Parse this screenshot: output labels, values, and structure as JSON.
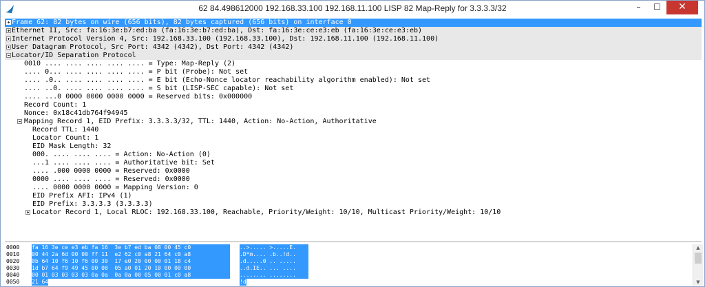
{
  "window": {
    "title": "62 84.498612000 192.168.33.100 192.168.11.100 LISP 82 Map-Reply for 3.3.3.3/32",
    "minimize": "–",
    "maximize": "☐",
    "close": "✕"
  },
  "tree": [
    {
      "text": "Frame 62: 82 bytes on wire (656 bits), 82 bytes captured (656 bits) on interface 0",
      "indent": 0,
      "expander": "plus",
      "selected": true
    },
    {
      "text": "Ethernet II, Src: fa:16:3e:b7:ed:ba (fa:16:3e:b7:ed:ba), Dst: fa:16:3e:ce:e3:eb (fa:16:3e:ce:e3:eb)",
      "indent": 0,
      "expander": "plus",
      "band": true
    },
    {
      "text": "Internet Protocol Version 4, Src: 192.168.33.100 (192.168.33.100), Dst: 192.168.11.100 (192.168.11.100)",
      "indent": 0,
      "expander": "plus",
      "band": true
    },
    {
      "text": "User Datagram Protocol, Src Port: 4342 (4342), Dst Port: 4342 (4342)",
      "indent": 0,
      "expander": "plus",
      "band": true
    },
    {
      "text": "Locator/ID Separation Protocol",
      "indent": 0,
      "expander": "minus",
      "band": true
    },
    {
      "text": "0010 .... .... .... .... .... = Type: Map-Reply (2)",
      "indent": 1
    },
    {
      "text": ".... 0... .... .... .... .... = P bit (Probe): Not set",
      "indent": 1
    },
    {
      "text": ".... .0.. .... .... .... .... = E bit (Echo-Nonce locator reachability algorithm enabled): Not set",
      "indent": 1
    },
    {
      "text": ".... ..0. .... .... .... .... = S bit (LISP-SEC capable): Not set",
      "indent": 1
    },
    {
      "text": ".... ...0 0000 0000 0000 0000 = Reserved bits: 0x000000",
      "indent": 1
    },
    {
      "text": "Record Count: 1",
      "indent": 1
    },
    {
      "text": "Nonce: 0x18c41db764f94945",
      "indent": 1
    },
    {
      "text": "Mapping Record 1, EID Prefix: 3.3.3.3/32, TTL: 1440, Action: No-Action, Authoritative",
      "indent": 1,
      "expander": "minus"
    },
    {
      "text": "Record TTL: 1440",
      "indent": 2
    },
    {
      "text": "Locator Count: 1",
      "indent": 2
    },
    {
      "text": "EID Mask Length: 32",
      "indent": 2
    },
    {
      "text": "000. .... .... .... = Action: No-Action (0)",
      "indent": 2
    },
    {
      "text": "...1 .... .... .... = Authoritative bit: Set",
      "indent": 2
    },
    {
      "text": ".... .000 0000 0000 = Reserved: 0x0000",
      "indent": 2
    },
    {
      "text": "0000 .... .... .... = Reserved: 0x0000",
      "indent": 2
    },
    {
      "text": ".... 0000 0000 0000 = Mapping Version: 0",
      "indent": 2
    },
    {
      "text": "EID Prefix AFI: IPv4 (1)",
      "indent": 2
    },
    {
      "text": "EID Prefix: 3.3.3.3 (3.3.3.3)",
      "indent": 2
    },
    {
      "text": "Locator Record 1, Local RLOC: 192.168.33.100, Reachable, Priority/Weight: 10/10, Multicast Priority/Weight: 10/10",
      "indent": 2,
      "expander": "plus"
    }
  ],
  "hex": [
    {
      "offset": "0000",
      "bytes": "fa 16 3e ce e3 eb fa 16  3e b7 ed ba 08 00 45 c0",
      "ascii": "..>..... >.....E."
    },
    {
      "offset": "0010",
      "bytes": "00 44 2a 6d 00 00 ff 11  e2 62 c0 a8 21 64 c0 a8",
      "ascii": ".D*m.... .b..!d.."
    },
    {
      "offset": "0020",
      "bytes": "0b 64 10 f6 10 f6 00 30  17 e0 20 00 00 01 18 c4",
      "ascii": ".d.....0 .. ....."
    },
    {
      "offset": "0030",
      "bytes": "1d b7 64 f9 49 45 00 00  05 a0 01 20 10 00 00 00",
      "ascii": "..d.IE.. ... ...."
    },
    {
      "offset": "0040",
      "bytes": "00 01 03 03 03 03 0a 0a  0a 0a 00 05 00 01 c0 a8",
      "ascii": "........ ........"
    },
    {
      "offset": "0050",
      "bytes": "21 64",
      "ascii": "!d"
    }
  ],
  "colors": {
    "selection": "#3399ff",
    "close": "#c7372f"
  }
}
